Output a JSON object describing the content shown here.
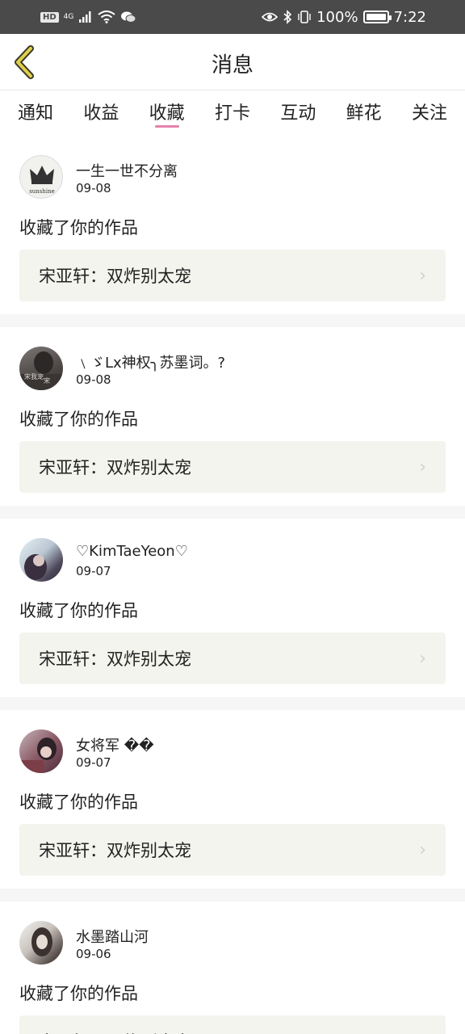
{
  "status_bar": {
    "hd": "HD",
    "network": "4G",
    "battery_percent": "100%",
    "battery_level": 1.0,
    "time": "7:22",
    "icons": [
      "signal-icon",
      "wifi-icon",
      "wechat-icon",
      "eye-icon",
      "bluetooth-icon",
      "vibrate-icon",
      "battery-icon"
    ]
  },
  "header": {
    "title": "消息",
    "back_icon": "chevron-left-icon",
    "back_color": "#e0cf4a"
  },
  "tabs": [
    {
      "label": "通知",
      "active": false
    },
    {
      "label": "收益",
      "active": false
    },
    {
      "label": "收藏",
      "active": true
    },
    {
      "label": "打卡",
      "active": false
    },
    {
      "label": "互动",
      "active": false
    },
    {
      "label": "鲜花",
      "active": false
    },
    {
      "label": "关注",
      "active": false
    }
  ],
  "accent_color": "#e582ad",
  "feed": [
    {
      "name": "一生一世不分离",
      "date": "09-08",
      "action": "收藏了你的作品",
      "work": "宋亚轩：双炸别太宠",
      "avatar_text": "sunshine"
    },
    {
      "name": "﹨ゞLx神权╮苏墨词。?",
      "date": "09-08",
      "action": "收藏了你的作品",
      "work": "宋亚轩：双炸别太宠",
      "avatar_text": "宋我宠 宋"
    },
    {
      "name": "♡KimTaeYeon♡",
      "date": "09-07",
      "action": "收藏了你的作品",
      "work": "宋亚轩：双炸别太宠"
    },
    {
      "name": "女将军 ��",
      "date": "09-07",
      "action": "收藏了你的作品",
      "work": "宋亚轩：双炸别太宠"
    },
    {
      "name": "水墨踏山河",
      "date": "09-06",
      "action": "收藏了你的作品",
      "work": "宋亚轩：双炸别太宠"
    }
  ],
  "chevron_glyph": "›"
}
